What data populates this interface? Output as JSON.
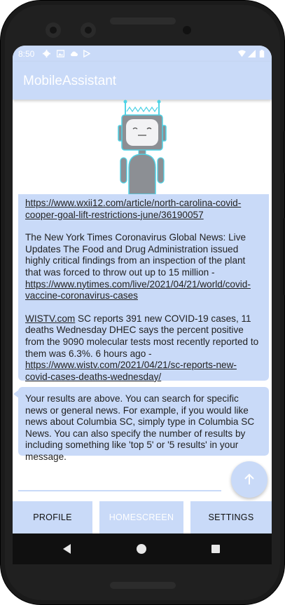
{
  "status_bar": {
    "time": "8:50"
  },
  "app_bar": {
    "title": "MobileAssistant"
  },
  "messages": [
    {
      "paragraphs": [
        {
          "text": "",
          "link": "https://www.wxii12.com/article/north-carolina-covid-cooper-goal-lift-restrictions-june/36190057"
        },
        {
          "text": "The New York Times Coronavirus Global News: Live Updates The Food and Drug Administration issued highly critical findings from an inspection of the plant that was forced to throw out up to 15 million - ",
          "link": "https://www.nytimes.com/live/2021/04/21/world/covid-vaccine-coronavirus-cases"
        },
        {
          "prefix_link": "WISTV.com",
          "text": " SC reports 391 new COVID-19 cases, 11 deaths Wednesday DHEC says the percent positive from the 9090 molecular tests most recently reported to them was 6.3%. 6 hours ago - ",
          "link": "https://www.wistv.com/2021/04/21/sc-reports-new-covid-cases-deaths-wednesday/"
        }
      ]
    },
    {
      "text": "Your results are above. You can search for specific news or general news. For example, if you would like news about Columbia SC, simply type in Columbia SC News. You can also specify the number of results by including something like 'top 5' or '5 results' in your message."
    }
  ],
  "input": {
    "value": ""
  },
  "nav": {
    "profile": "PROFILE",
    "homescreen": "HOMESCREEN",
    "settings": "SETTINGS"
  },
  "colors": {
    "accent": "#c9daf8",
    "robot_body": "#8c8f94",
    "robot_outline": "#4fd3e6"
  },
  "icons": [
    "settings-icon",
    "image-icon",
    "cloud-icon",
    "play-icon",
    "wifi-icon",
    "signal-icon",
    "battery-icon",
    "send-arrow-icon",
    "back-icon",
    "home-icon",
    "recents-icon"
  ]
}
